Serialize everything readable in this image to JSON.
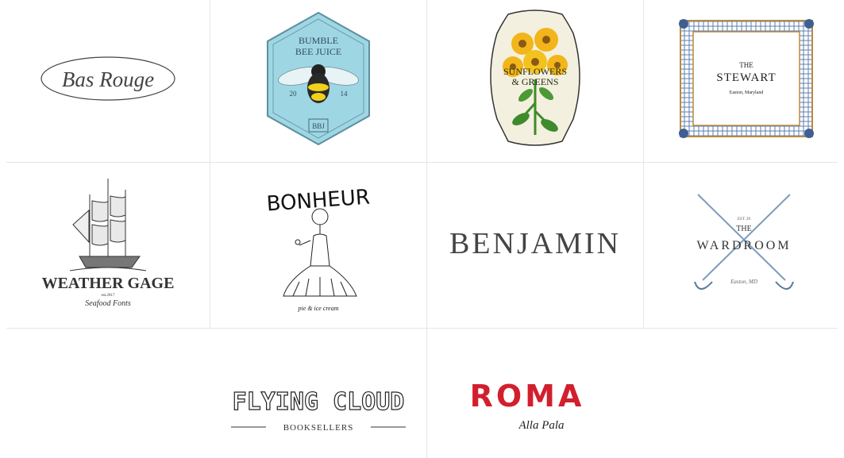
{
  "logos": {
    "bas_rouge": {
      "name": "Bas Rouge"
    },
    "bumble_bee": {
      "line1": "BUMBLE",
      "line2": "BEE JUICE",
      "year_left": "20",
      "year_right": "14",
      "monogram": "BBJ"
    },
    "sunflowers": {
      "line1": "SUNFLOWERS",
      "line2": "& GREENS"
    },
    "stewart": {
      "the": "THE",
      "name": "STEWART",
      "place": "Easton, Maryland"
    },
    "weather_gage": {
      "name": "WEATHER GAGE",
      "est": "est.2017",
      "script": "Seafood Fonts"
    },
    "bonheur": {
      "name": "BONHEUR",
      "tagline": "pie & ice cream"
    },
    "benjamin": {
      "name": "BENJAMIN"
    },
    "wardroom": {
      "est": "EST. 20",
      "the": "THE",
      "name": "WARDROOM",
      "script": "Easton, MD"
    },
    "flying_cloud": {
      "name": "FLYING CLOUD",
      "sub": "BOOKSELLERS"
    },
    "roma": {
      "name": "ROMA",
      "sub": "Alla Pala"
    }
  },
  "colors": {
    "roma_red": "#d21f2e",
    "bee_blue": "#9fd6e3",
    "stewart_plaid": "#5b7db4",
    "stewart_border": "#b98a3c",
    "sunflower_yellow": "#f2b51a",
    "leaf_green": "#3f8a2c"
  }
}
